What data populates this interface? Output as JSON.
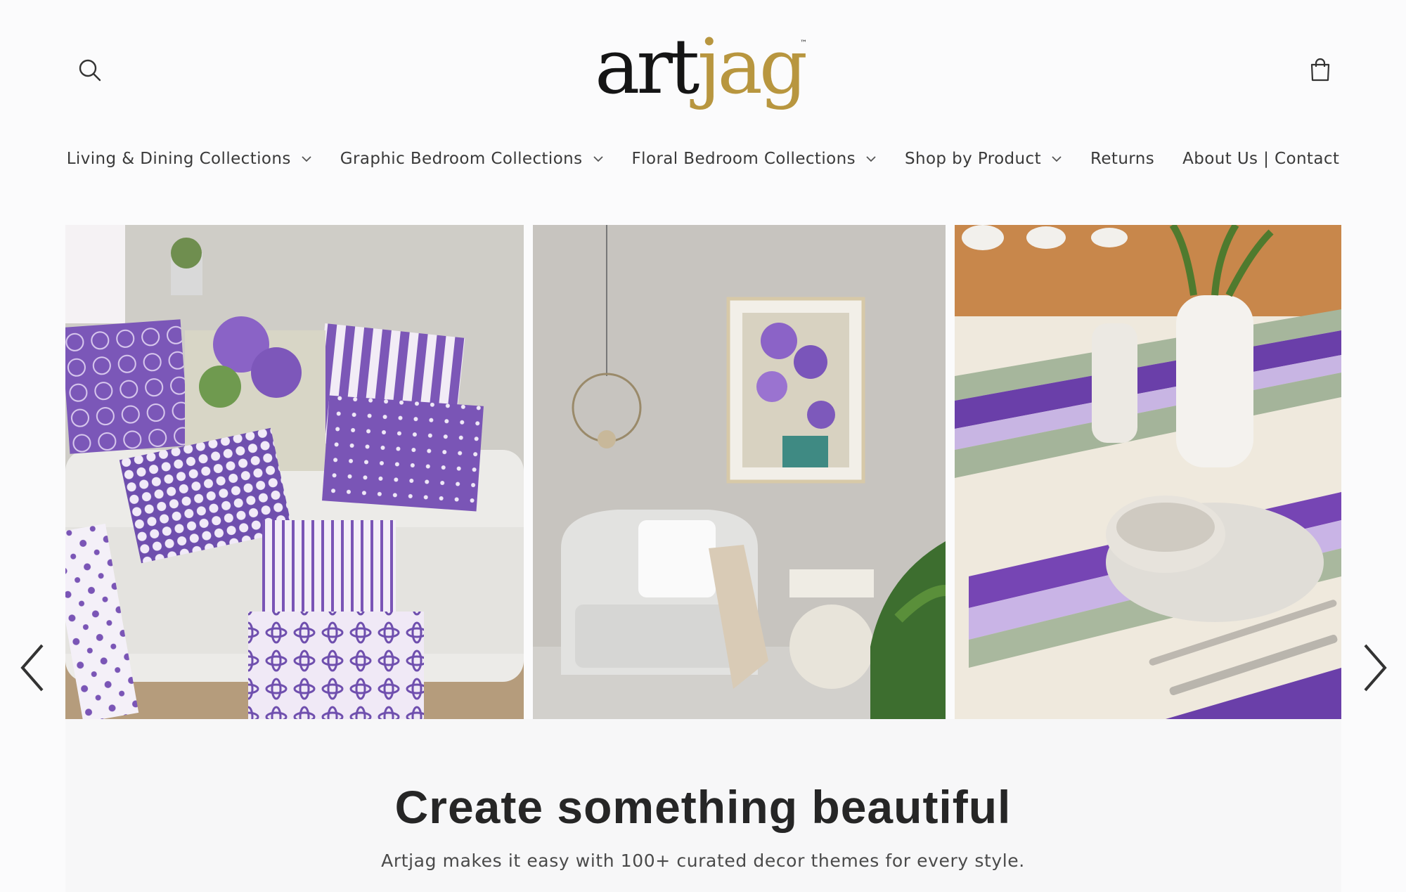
{
  "brand": {
    "part1": "art",
    "part2": "jag",
    "tm": "™"
  },
  "colors": {
    "brand_gold": "#b8963f",
    "accent_purple": "#7a55b6",
    "text": "#2b2b2b"
  },
  "header": {
    "search_icon": "search-icon",
    "cart_icon": "shopping-bag-icon"
  },
  "nav": {
    "items": [
      {
        "label": "Living & Dining Collections",
        "has_dropdown": true
      },
      {
        "label": "Graphic Bedroom Collections",
        "has_dropdown": true
      },
      {
        "label": "Floral Bedroom Collections",
        "has_dropdown": true
      },
      {
        "label": "Shop by Product",
        "has_dropdown": true
      },
      {
        "label": "Returns",
        "has_dropdown": false
      },
      {
        "label": "About Us | Contact",
        "has_dropdown": false
      }
    ]
  },
  "hero": {
    "slides": [
      "living-room-purple-pillows",
      "armchair-floral-art",
      "dining-table-purple-placemats"
    ],
    "prev_icon": "chevron-left-icon",
    "next_icon": "chevron-right-icon"
  },
  "intro": {
    "headline": "Create something beautiful",
    "subtext": "Artjag makes it easy with 100+ curated decor themes for every style."
  }
}
